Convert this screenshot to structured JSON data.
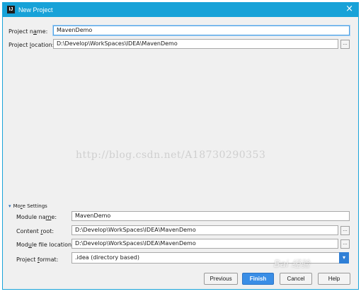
{
  "window": {
    "title": "New Project",
    "app_icon": "IJ",
    "close_glyph": "×"
  },
  "project": {
    "name_label": "Project name:",
    "name_value": "MavenDemo",
    "location_label": "Project location:",
    "location_value": "D:\\Develop\\WorkSpaces\\IDEA\\MavenDemo",
    "browse_glyph": "..."
  },
  "watermark_text": "http://blog.csdn.net/A18730290353",
  "more_settings": {
    "toggle_label": "More Settings",
    "module_name_label": "Module name:",
    "module_name_value": "MavenDemo",
    "content_root_label": "Content root:",
    "content_root_value": "D:\\Develop\\WorkSpaces\\IDEA\\MavenDemo",
    "module_file_label": "Module file location:",
    "module_file_value": "D:\\Develop\\WorkSpaces\\IDEA\\MavenDemo",
    "format_label": "Project format:",
    "format_value": ".idea (directory based)"
  },
  "buttons": {
    "previous": "Previous",
    "finish": "Finish",
    "cancel": "Cancel",
    "help": "Help"
  },
  "baidu_watermark": "Bai 经验",
  "colors": {
    "titlebar": "#17a2d8",
    "finish": "#3a8ee6",
    "dropdown": "#2f7fd6"
  }
}
